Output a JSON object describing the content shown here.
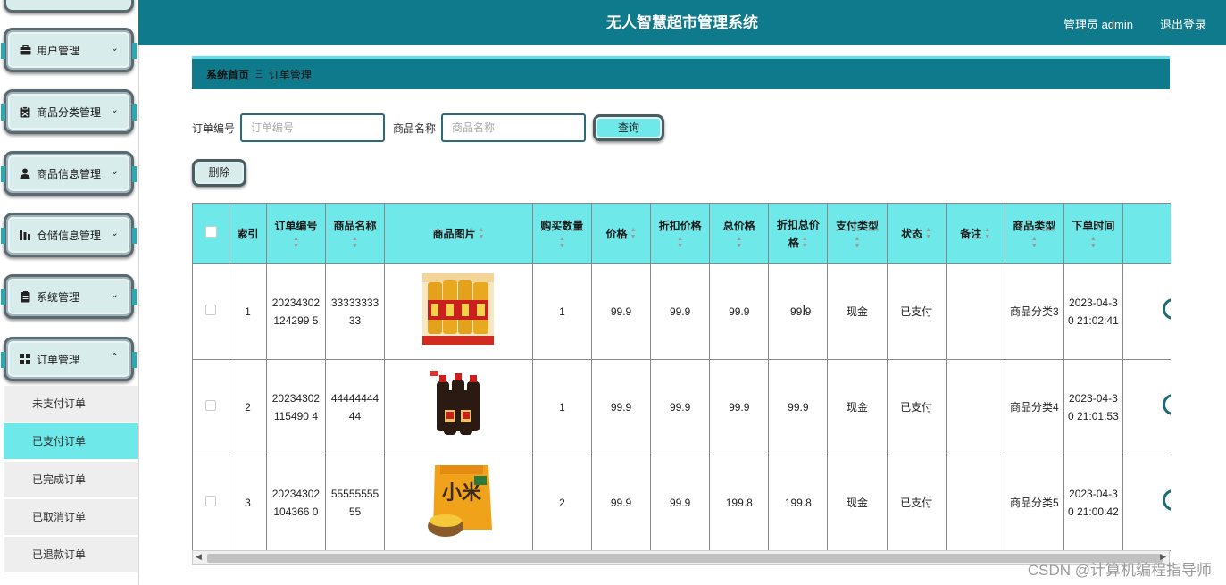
{
  "header": {
    "title": "无人智慧超市管理系统",
    "admin_label": "管理员 admin",
    "logout_label": "退出登录"
  },
  "sidebar": {
    "menus": [
      {
        "label": "用户管理",
        "icon": "briefcase-icon",
        "chevron": "⌄"
      },
      {
        "label": "商品分类管理",
        "icon": "clipboard-icon",
        "chevron": "⌄"
      },
      {
        "label": "商品信息管理",
        "icon": "user-icon",
        "chevron": "⌄"
      },
      {
        "label": "仓储信息管理",
        "icon": "barchart-icon",
        "chevron": "⌄"
      },
      {
        "label": "系统管理",
        "icon": "document-icon",
        "chevron": "⌄"
      },
      {
        "label": "订单管理",
        "icon": "grid-icon",
        "chevron": "⌃"
      }
    ],
    "submenu": [
      {
        "label": "未支付订单",
        "active": false
      },
      {
        "label": "已支付订单",
        "active": true
      },
      {
        "label": "已完成订单",
        "active": false
      },
      {
        "label": "已取消订单",
        "active": false
      },
      {
        "label": "已退款订单",
        "active": false
      }
    ]
  },
  "breadcrumb": {
    "home": "系统首页",
    "separator": "Ξ",
    "current": "订单管理"
  },
  "search": {
    "order_no_label": "订单编号",
    "order_no_placeholder": "订单编号",
    "order_no_value": "",
    "product_name_label": "商品名称",
    "product_name_placeholder": "商品名称",
    "product_name_value": "",
    "query_button": "查询"
  },
  "toolbar": {
    "delete_button": "删除"
  },
  "table": {
    "headers": [
      "索引",
      "订单编号",
      "商品名称",
      "商品图片",
      "购买数量",
      "价格",
      "折扣价格",
      "总价格",
      "折扣总价格",
      "支付类型",
      "状态",
      "备注",
      "商品类型",
      "下单时间"
    ],
    "rows": [
      {
        "index": "1",
        "order_no": "20234302124299 5",
        "product_name": "3333333333",
        "image": "cooking-oil-bottles",
        "quantity": "1",
        "price": "99.9",
        "discount_price": "99.9",
        "total_price": "99.9",
        "discount_total": "99.9",
        "payment_type": "现金",
        "status": "已支付",
        "remark": "",
        "category": "商品分类3",
        "order_time": "2023-04-30 21:02:41"
      },
      {
        "index": "2",
        "order_no": "20234302115490 4",
        "product_name": "4444444444",
        "image": "soy-sauce-bottles",
        "quantity": "1",
        "price": "99.9",
        "discount_price": "99.9",
        "total_price": "99.9",
        "discount_total": "99.9",
        "payment_type": "现金",
        "status": "已支付",
        "remark": "",
        "category": "商品分类4",
        "order_time": "2023-04-30 21:01:53"
      },
      {
        "index": "3",
        "order_no": "20234302104366 0",
        "product_name": "5555555555",
        "image": "millet-bag",
        "quantity": "2",
        "price": "99.9",
        "discount_price": "99.9",
        "total_price": "199.8",
        "discount_total": "199.8",
        "payment_type": "现金",
        "status": "已支付",
        "remark": "",
        "category": "商品分类5",
        "order_time": "2023-04-30 21:00:42"
      }
    ]
  },
  "watermark": "CSDN @计算机编程指导师",
  "colors": {
    "header_bg": "#0f7a8c",
    "accent_cyan": "#6ee8e8",
    "menu_bg": "#d9ecec"
  }
}
